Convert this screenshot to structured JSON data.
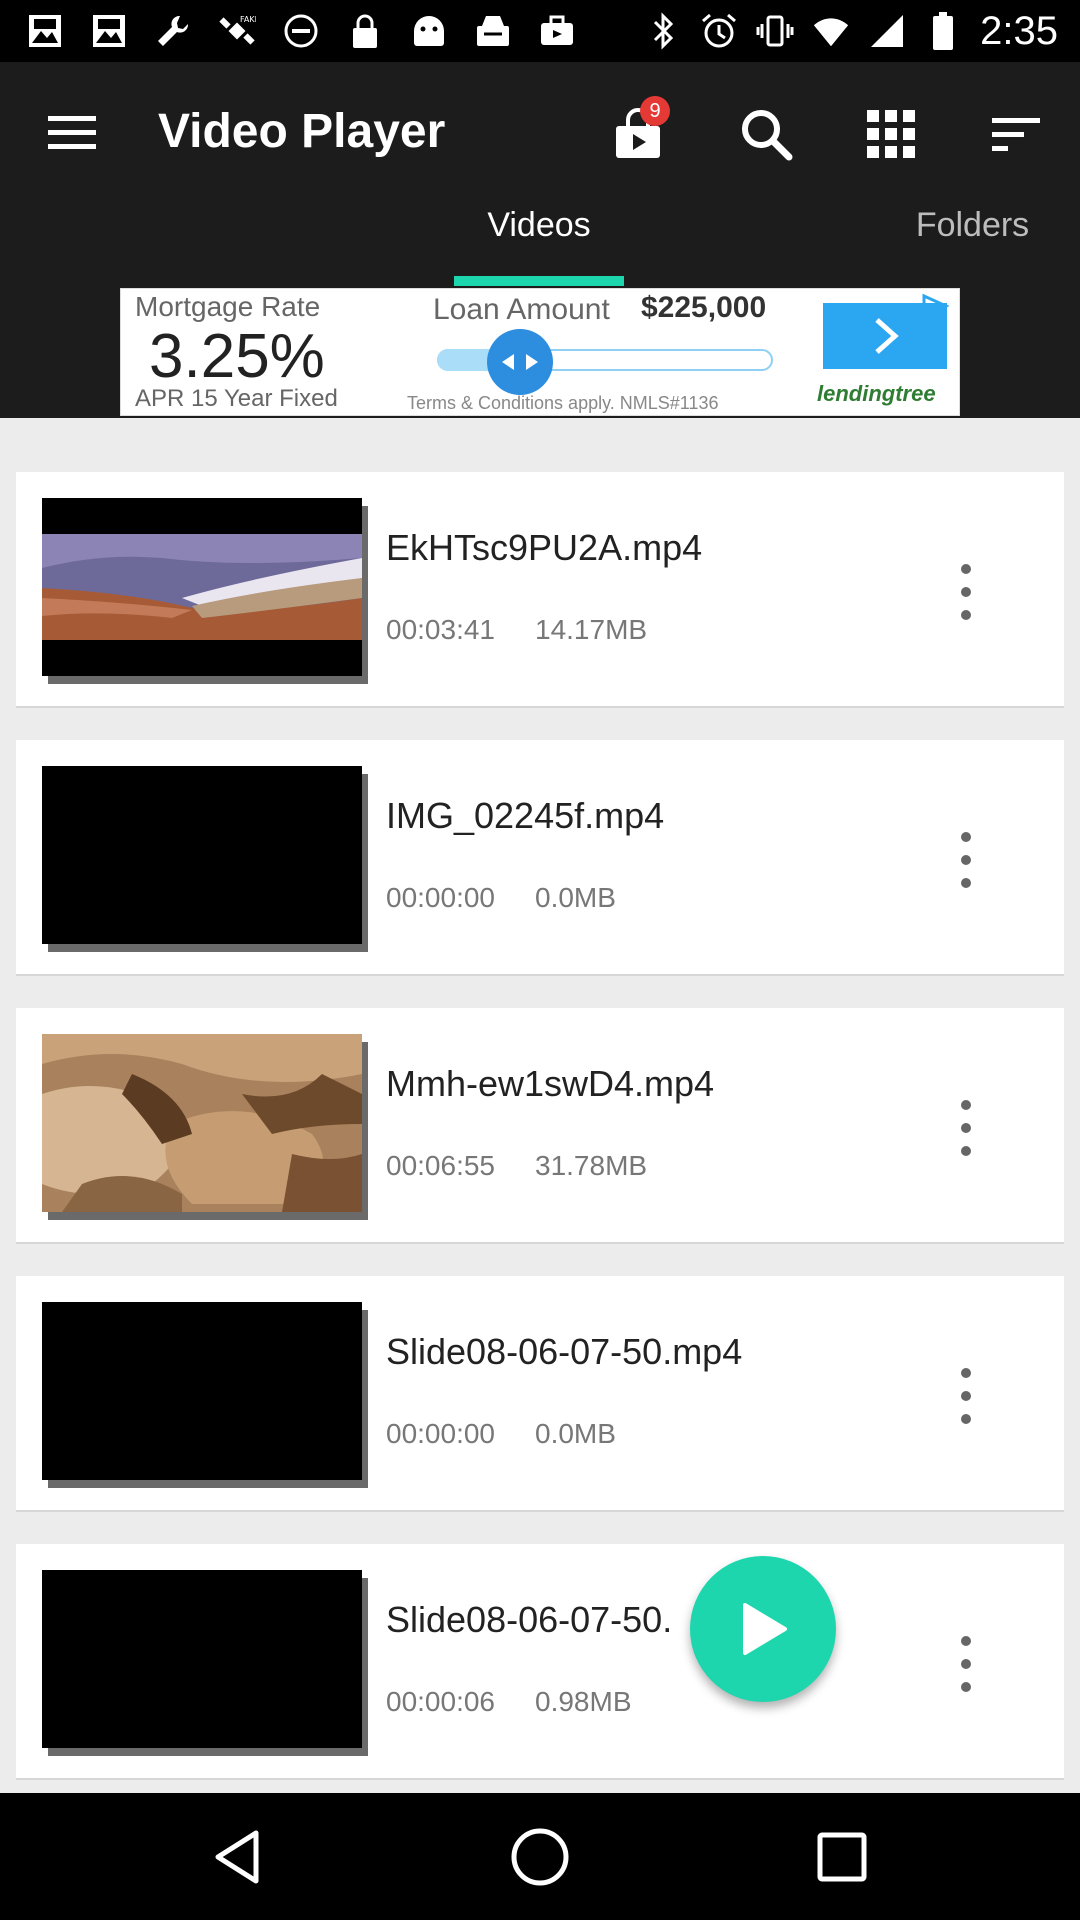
{
  "status_bar": {
    "time": "2:35",
    "left_icons": [
      "image-icon",
      "image-icon",
      "wrench-icon",
      "satellite-icon",
      "do-not-disturb-icon",
      "lock-icon",
      "android-icon",
      "inbox-icon",
      "briefcase-icon"
    ],
    "right_icons": [
      "bluetooth-icon",
      "alarm-icon",
      "vibrate-icon",
      "wifi-icon",
      "signal-icon",
      "battery-icon"
    ]
  },
  "app_bar": {
    "title": "Video Player",
    "notification_count": "9",
    "tabs": [
      {
        "label": "Videos",
        "active": true
      },
      {
        "label": "Folders",
        "active": false
      }
    ],
    "accent_color": "#1dd6ae"
  },
  "ad": {
    "mortgage_label": "Mortgage Rate",
    "rate": "3.25%",
    "apr_text": "APR 15 Year Fixed",
    "loan_label": "Loan Amount",
    "loan_amount": "$225,000",
    "terms": "Terms & Conditions apply. NMLS#1136",
    "brand": "lendingtree"
  },
  "videos": [
    {
      "title": "EkHTsc9PU2A.mp4",
      "duration": "00:03:41",
      "size": "14.17MB",
      "thumb": "beach"
    },
    {
      "title": "IMG_02245f.mp4",
      "duration": "00:00:00",
      "size": "0.0MB",
      "thumb": "black"
    },
    {
      "title": "Mmh-ew1swD4.mp4",
      "duration": "00:06:55",
      "size": "31.78MB",
      "thumb": "rocks"
    },
    {
      "title": "Slide08-06-07-50.mp4",
      "duration": "00:00:00",
      "size": "0.0MB",
      "thumb": "black"
    },
    {
      "title": "Slide08-06-07-50.",
      "duration": "00:00:06",
      "size": "0.98MB",
      "thumb": "black"
    }
  ]
}
